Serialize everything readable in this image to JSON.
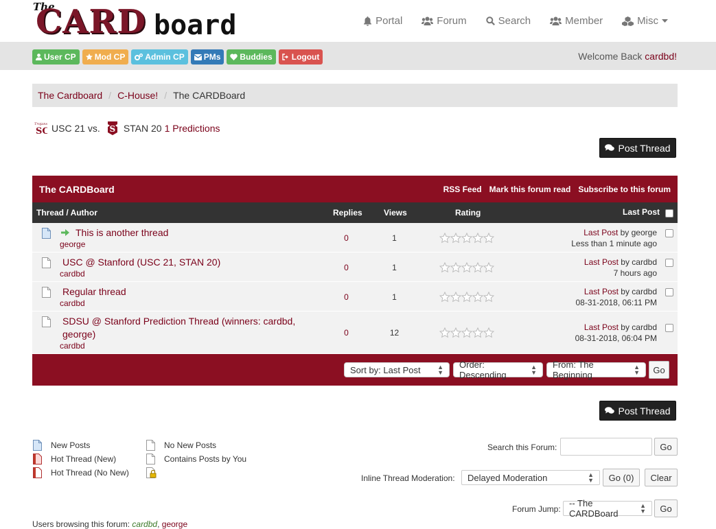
{
  "logo": {
    "the": "The",
    "card": "CARD",
    "board": "board"
  },
  "nav": [
    {
      "label": "Portal",
      "icon": "bell-icon"
    },
    {
      "label": "Forum",
      "icon": "users-icon"
    },
    {
      "label": "Search",
      "icon": "search-icon"
    },
    {
      "label": "Member",
      "icon": "users-icon"
    },
    {
      "label": "Misc",
      "icon": "cubes-icon"
    }
  ],
  "usernav": [
    {
      "label": "User CP",
      "color": "#5cb85c",
      "icon": "user-icon"
    },
    {
      "label": "Mod CP",
      "color": "#f0ad4e",
      "icon": "star-icon"
    },
    {
      "label": "Admin CP",
      "color": "#5bc0de",
      "icon": "cogs-icon"
    },
    {
      "label": "PMs",
      "color": "#337ab7",
      "icon": "envelope-icon"
    },
    {
      "label": "Buddies",
      "color": "#5cb85c",
      "icon": "heart-icon"
    },
    {
      "label": "Logout",
      "color": "#d9534f",
      "icon": "signout-icon"
    }
  ],
  "welcome": {
    "text": "Welcome Back",
    "user": "cardbd",
    "suffix": "!"
  },
  "breadcrumb": [
    "The Cardboard",
    "C-House!",
    "The CARDBoard"
  ],
  "game": {
    "team1": "USC 21 vs.",
    "team2": "STAN 20",
    "predictions": "1 Predictions"
  },
  "post_thread_label": "Post Thread",
  "forum": {
    "title": "The CARDBoard",
    "tools": [
      "RSS Feed",
      "Mark this forum read",
      "Subscribe to this forum"
    ],
    "columns": {
      "thread": "Thread / Author",
      "replies": "Replies",
      "views": "Views",
      "rating": "Rating",
      "lastpost": "Last Post"
    },
    "threads": [
      {
        "title": "This is another thread",
        "author": "george",
        "replies": "0",
        "views": "1",
        "last_link": "Last Post",
        "last_by": "by george",
        "last_time": "Less than 1 minute ago"
      },
      {
        "title": "USC @ Stanford (USC 21, STAN 20)",
        "author": "cardbd",
        "replies": "0",
        "views": "1",
        "last_link": "Last Post",
        "last_by": "by cardbd",
        "last_time": "7 hours ago"
      },
      {
        "title": "Regular thread",
        "author": "cardbd",
        "replies": "0",
        "views": "1",
        "last_link": "Last Post",
        "last_by": "by cardbd",
        "last_time": "08-31-2018, 06:11 PM"
      },
      {
        "title": "SDSU @ Stanford Prediction Thread (winners: cardbd, george)",
        "author": "cardbd",
        "replies": "0",
        "views": "12",
        "last_link": "Last Post",
        "last_by": "by cardbd",
        "last_time": "08-31-2018, 06:04 PM"
      }
    ],
    "sort": {
      "sort_by": "Sort by: Last Post",
      "order": "Order: Descending",
      "from": "From: The Beginning",
      "go": "Go"
    }
  },
  "legend": {
    "new_posts": "New Posts",
    "hot_new": "Hot Thread (New)",
    "hot_no_new": "Hot Thread (No New)",
    "no_new": "No New Posts",
    "contains_you": "Contains Posts by You"
  },
  "search_forum": {
    "label": "Search this Forum:",
    "value": "",
    "go": "Go"
  },
  "moderation": {
    "label": "Inline Thread Moderation:",
    "selected": "Delayed Moderation",
    "go": "Go (0)",
    "clear": "Clear"
  },
  "forum_jump": {
    "label": "Forum Jump:",
    "selected": "-- The CARDBoard",
    "go": "Go"
  },
  "browsing": {
    "label": "Users browsing this forum:",
    "user1": "cardbd",
    "sep": ",",
    "user2": "george"
  }
}
